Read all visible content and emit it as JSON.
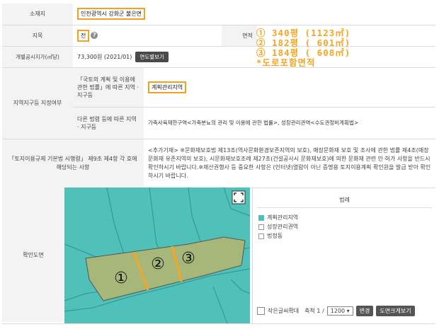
{
  "info": {
    "location_label": "소재지",
    "location_value": "인천광역시 강화군 불은면",
    "jimok_label": "지목",
    "jimok_value": "전",
    "jimok_help_icon": "?",
    "area_label": "면적",
    "area_lines": [
      "① 340평 (1123㎡)",
      "② 182평 ( 601㎡)",
      "③ 184평 ( 608㎡)",
      "*도로포함면적"
    ],
    "price_label": "개별공시지가(㎡당)",
    "price_value": "73,300원 (2021/01)",
    "price_button": "연도별보기",
    "zone_label": "지역지구등 지정여부",
    "zone_sub1_label": "「국토의 계획 및 이용에 관한 법률」에 따른 지역 · 지구등",
    "zone_sub1_value": "계획관리지역",
    "zone_sub2_label": "다른 법령 등에 따른 지역 · 지구등",
    "zone_sub2_value": "가축사육제한구역<가축분뇨의 관리 및 이용에 관한 법률>, 성장관리권역<수도권정비계획법>",
    "regulation_label": "「토지이용규제 기본법 시행령」 제9조 제4항 각 호에 해당되는 사항",
    "regulation_note": "<추가기재> ※문화재보호법 제13조(역사문화환경보존지역의 보호), 매장문화재 보호 및 조사에 관한 법률 제4조(매장문화재 유존지역의 보호), 시문화재보호조례 제27조(건설공사시 문화재보호)에 의한 문화재 관련 인·허가 사항을 반드시 확인하시기 바랍니다.※재산권행사 등 중요한 사항은 (인터넷)열람이 아닌 증명용 토지이용계획 확인원을 발급 받아 확인하시기 바랍니다."
  },
  "map": {
    "label": "확인도면",
    "parcel_labels": [
      "①",
      "②",
      "③"
    ],
    "fullscreen_icon": "fullscreen-icon",
    "colors": {
      "plan_zone": "#4fc1b9",
      "parcel": "#a6b779",
      "divider": "#f5a623"
    }
  },
  "legend": {
    "title": "범례",
    "items": [
      "계획관리지역",
      "성장관리권역",
      "법정동"
    ],
    "small_text_label": "작은글씨확대",
    "scale_label": "축척 1 /",
    "scale_value": "1200",
    "change_button": "변경",
    "enlarge_button": "도면크게보기"
  }
}
